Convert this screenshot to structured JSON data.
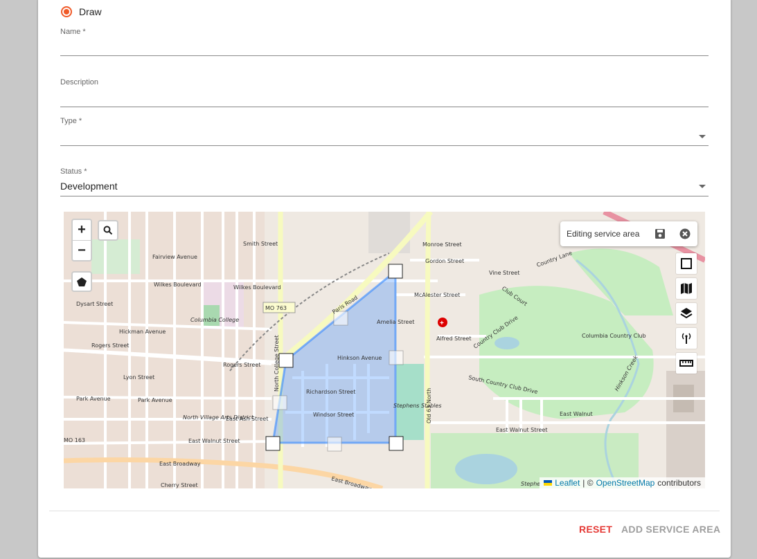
{
  "form": {
    "draw_label": "Draw",
    "name_label": "Name *",
    "name_value": "",
    "description_label": "Description",
    "description_value": "",
    "type_label": "Type *",
    "type_value": "",
    "status_label": "Status *",
    "status_value": "Development"
  },
  "map": {
    "zoom_in": "+",
    "zoom_out": "−",
    "editing_label": "Editing service area",
    "attribution": {
      "leaflet": "Leaflet",
      "sep": "| ©",
      "osm": "OpenStreetMap",
      "contributors": "contributors"
    },
    "labels": {
      "mo763": "MO 763",
      "mo163": "MO 163",
      "paris_road": "Paris Road",
      "college_street": "North College Street",
      "rogers_street": "Rogers Street",
      "wilkes_blvd": "Wilkes Boulevard",
      "wilkes_blvd2": "Wilkes Boulevard",
      "hinkson_ave": "Hinkson Avenue",
      "richardson": "Richardson Street",
      "windsor": "Windsor Street",
      "amelia": "Amelia Street",
      "alfred": "Alfred Street",
      "mcalester": "McAlester Street",
      "gordon": "Gordon Street",
      "monroe": "Monroe Street",
      "vine": "Vine Street",
      "club_court": "Club Court",
      "country_lane": "Country Lane",
      "country_club_drive": "Country Club Drive",
      "south_country_club": "South Country Club Drive",
      "east_walnut": "East Walnut Street",
      "east_walnut2": "East Walnut",
      "east_broadway": "East Broadway",
      "east_broadway2": "East Broadway",
      "east_ash": "East Ash Street",
      "park_avenue": "Park Avenue",
      "park_avenue2": "Park Avenue",
      "lyon": "Lyon Street",
      "hickman": "Hickman Avenue",
      "dysart": "Dysart Street",
      "fairview": "Fairview Avenue",
      "smith": "Smith Street",
      "cherry": "Cherry Street",
      "columbia_college": "Columbia College",
      "north_village": "North Village Arts District",
      "stephens_stables": "Stephens Stables",
      "columbia_cc": "Columbia Country Club",
      "hinkson_creek": "Hinkson Creek",
      "old63": "Old 63 North",
      "stephens": "Stephe"
    }
  },
  "actions": {
    "reset": "RESET",
    "add": "ADD SERVICE AREA"
  },
  "colors": {
    "accent": "#f05a28",
    "reset": "#e53935",
    "disabled": "#9e9e9e",
    "polygon": "#3388ff"
  }
}
